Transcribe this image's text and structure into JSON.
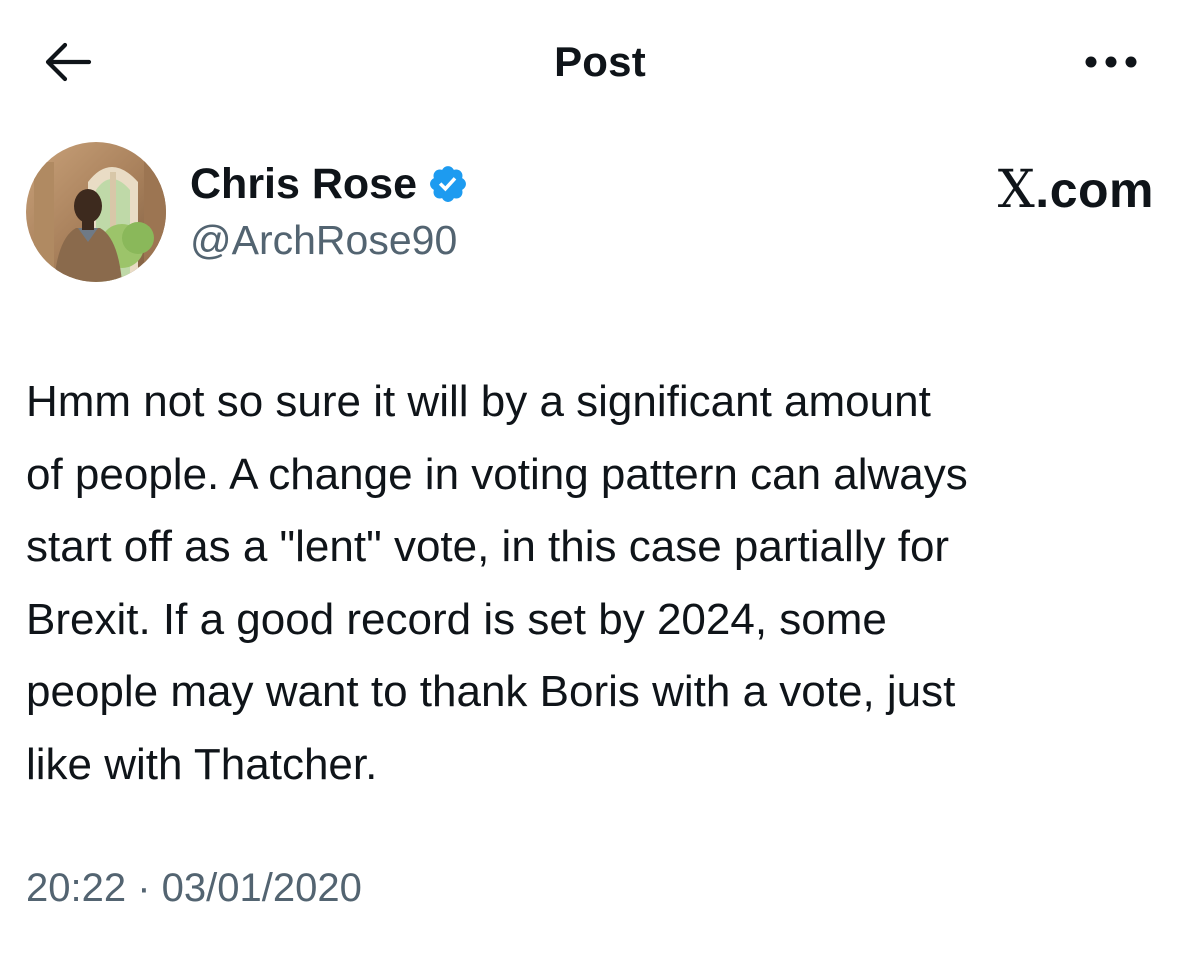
{
  "header": {
    "title": "Post",
    "back_icon": "arrow-left-icon",
    "more_icon": "more-horizontal-icon"
  },
  "author": {
    "display_name": "Chris Rose",
    "handle": "@ArchRose90",
    "verified": true,
    "verified_color": "#1d9bf0"
  },
  "brand": {
    "mark": "X",
    "domain": ".com"
  },
  "post": {
    "text": "Hmm not so sure it will by a significant amount\nof people. A change in voting pattern can always\nstart off as a \"lent\" vote, in this case partially for\nBrexit. If a good record is set by 2024, some\npeople may want to thank Boris with a vote, just\nlike with Thatcher.",
    "timestamp": "20:22 · 03/01/2020"
  },
  "colors": {
    "text_primary": "#0f1419",
    "text_secondary": "#536471",
    "background": "#ffffff"
  }
}
